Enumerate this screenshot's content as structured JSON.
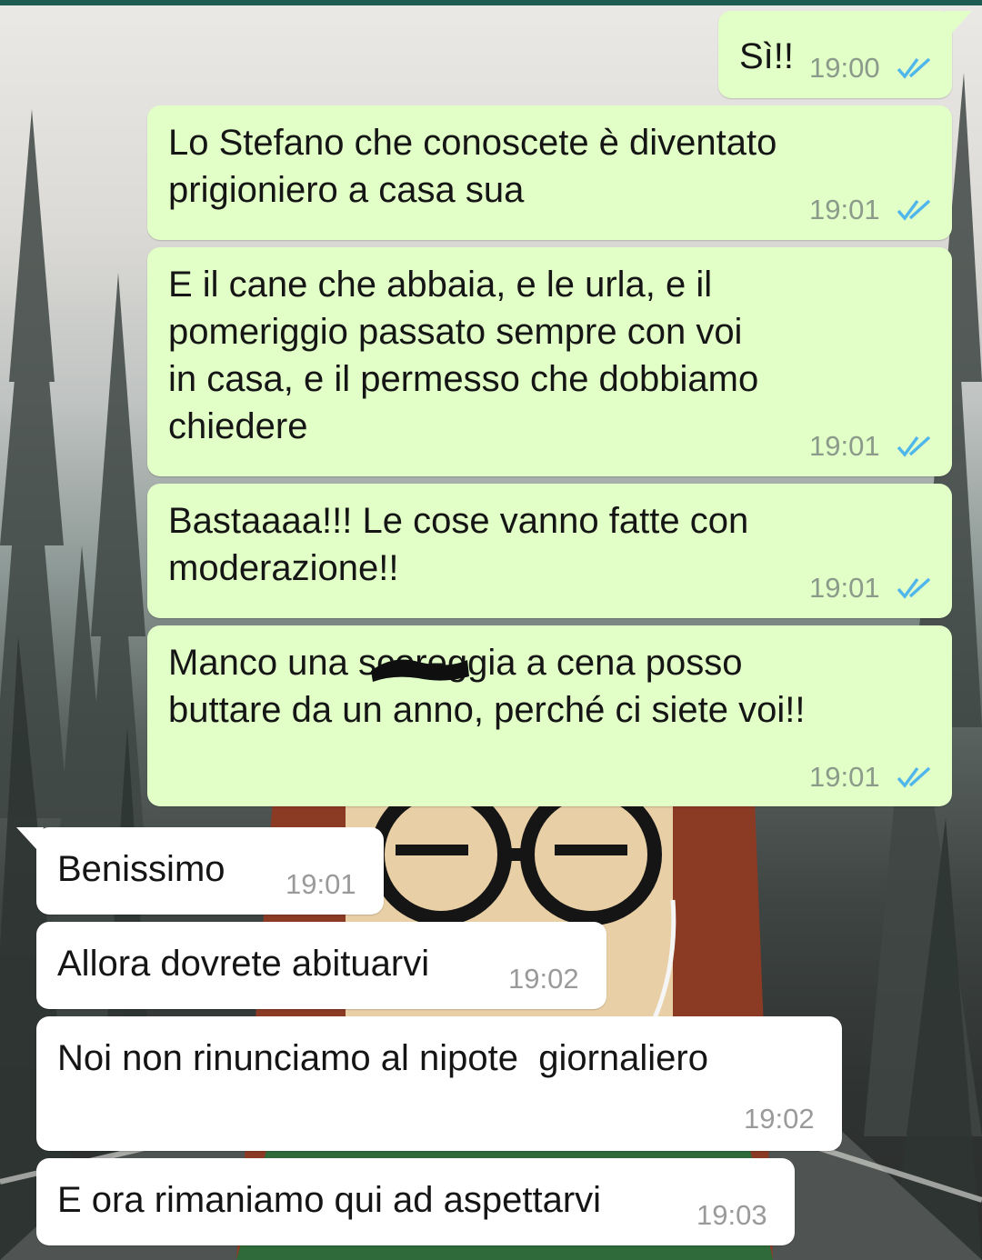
{
  "chat": {
    "outgoing": [
      {
        "text": "Sì!!",
        "time": "19:00",
        "status": "read-double-check-icon"
      },
      {
        "text": "Lo Stefano che conoscete è diventato\nprigioniero a casa sua",
        "time": "19:01",
        "status": "read-double-check-icon"
      },
      {
        "text": "E il cane che abbaia, e le urla, e il\npomeriggio passato sempre con voi\nin casa, e il permesso che dobbiamo\nchiedere",
        "time": "19:01",
        "status": "read-double-check-icon"
      },
      {
        "text": "Bastaaaa!!! Le cose vanno fatte con\nmoderazione!!",
        "time": "19:01",
        "status": "read-double-check-icon"
      },
      {
        "text": "Manco una scoreggia a cena posso\nbuttare da un anno, perché ci siete voi!!",
        "time": "19:01",
        "status": "read-double-check-icon"
      }
    ],
    "incoming": [
      {
        "text": "Benissimo",
        "time": "19:01"
      },
      {
        "text": "Allora dovrete abituarvi",
        "time": "19:02"
      },
      {
        "text": "Noi non rinunciamo al nipote  giornaliero",
        "time": "19:02"
      },
      {
        "text": "E ora rimaniamo qui ad aspettarvi",
        "time": "19:03"
      }
    ]
  },
  "colors": {
    "outgoing_bubble": "#e1ffc7",
    "incoming_bubble": "#ffffff",
    "read_tick": "#4fb6ec",
    "header_strip": "#1d5c50"
  }
}
